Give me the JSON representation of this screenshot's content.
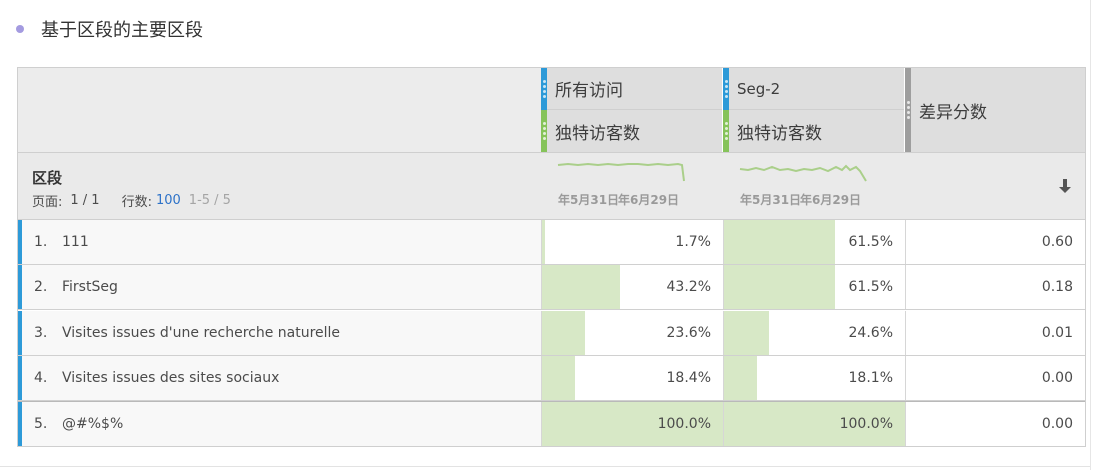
{
  "panel": {
    "title": "基于区段的主要区段"
  },
  "columns": [
    {
      "segment": "所有访问",
      "metric": "独特访客数"
    },
    {
      "segment": "Seg-2",
      "metric": "独特访客数"
    },
    {
      "metric": "差异分数"
    }
  ],
  "summary": {
    "dimension": "区段",
    "page_label": "页面:",
    "page_value": "1 / 1",
    "rows_label": "行数:",
    "rows_value": "100",
    "range": "1-5 / 5",
    "sparkline_dates": [
      "年5月31日",
      "年6月29日"
    ]
  },
  "rows": [
    {
      "num": "1.",
      "name": "111",
      "c1": "1.7%",
      "c2": "61.5%",
      "diff": "0.60",
      "c1_pct": 1.7,
      "c2_pct": 61.5
    },
    {
      "num": "2.",
      "name": "FirstSeg",
      "c1": "43.2%",
      "c2": "61.5%",
      "diff": "0.18",
      "c1_pct": 43.2,
      "c2_pct": 61.5
    },
    {
      "num": "3.",
      "name": "Visites issues d'une recherche naturelle",
      "c1": "23.6%",
      "c2": "24.6%",
      "diff": "0.01",
      "c1_pct": 23.6,
      "c2_pct": 24.6
    },
    {
      "num": "4.",
      "name": "Visites issues des sites sociaux",
      "c1": "18.4%",
      "c2": "18.1%",
      "diff": "0.00",
      "c1_pct": 18.4,
      "c2_pct": 18.1
    },
    {
      "num": "5.",
      "name": "@#%$%",
      "c1": "100.0%",
      "c2": "100.0%",
      "diff": "0.00",
      "c1_pct": 100.0,
      "c2_pct": 100.0
    }
  ],
  "icons": {
    "sort": "sort-descending-icon",
    "bullet": "panel-bullet-icon"
  },
  "colors": {
    "segment_bar": "#2d9ad8",
    "metric_bar": "#86c35a",
    "bar_fill": "#d7e8c6",
    "link": "#2d72c8"
  }
}
